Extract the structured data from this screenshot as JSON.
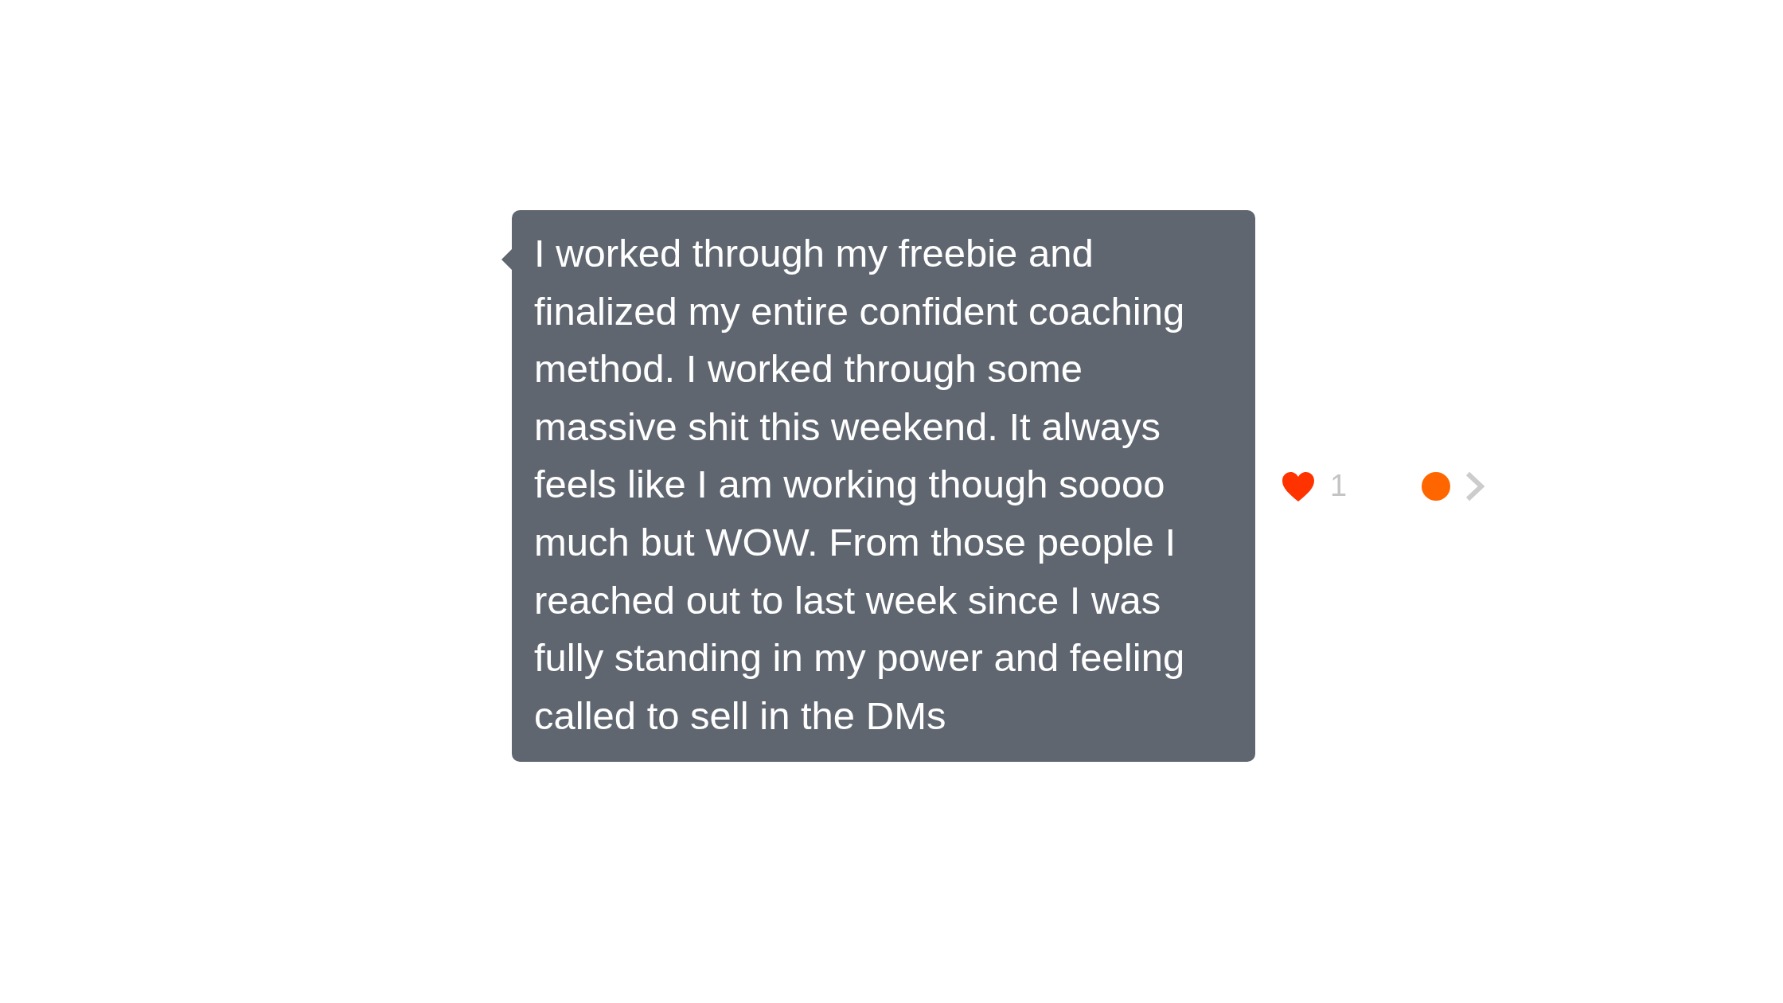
{
  "message": {
    "text": "I worked through my freebie and finalized my entire confident coaching method. I worked through some massive shit this weekend. It always feels like I am working though soooo much but WOW. From those people I reached out to last week since I was fully standing in my power and feeling called to sell in the DMs"
  },
  "reactions": {
    "like_count": "1"
  }
}
